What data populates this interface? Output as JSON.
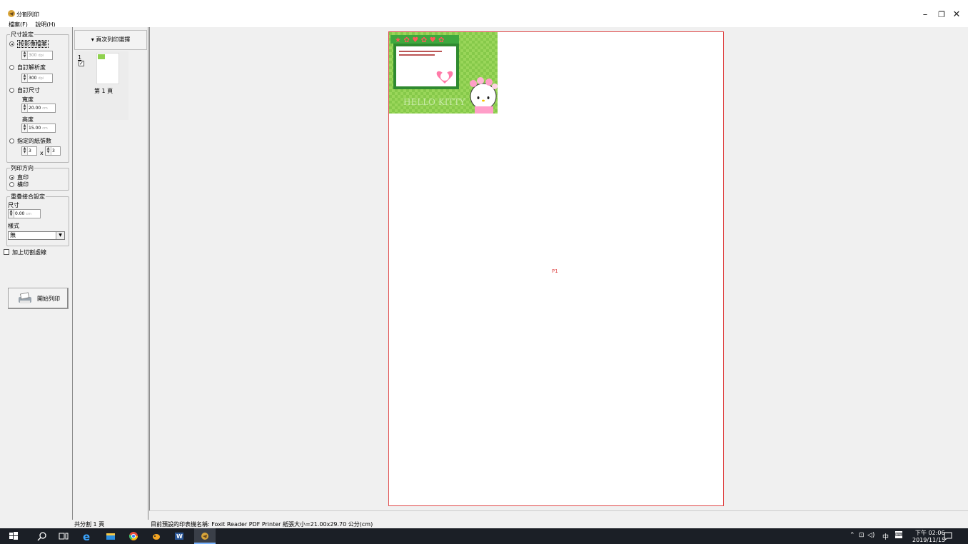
{
  "window": {
    "title": "分割列印",
    "menu": [
      "檔案(F)",
      "說明(H)"
    ],
    "controls": {
      "minimize": "–",
      "restore": "❐",
      "close": "✕"
    }
  },
  "size_settings": {
    "legend": "尺寸設定",
    "by_image": {
      "label": "按影像檔案",
      "value": "300",
      "unit": "dpi",
      "selected": true
    },
    "custom_resolution": {
      "label": "自訂解析度",
      "value": "300",
      "unit": "dpi"
    },
    "custom_size": {
      "label": "自訂尺寸",
      "width_label": "寬度",
      "width_value": "20.00",
      "height_label": "高度",
      "height_value": "15.00",
      "unit": "cm"
    },
    "page_count": {
      "label": "指定的紙張數",
      "cols": "3",
      "rows": "3",
      "separator": "x"
    }
  },
  "orientation": {
    "legend": "列印方向",
    "portrait": "直印",
    "landscape": "橫印",
    "selected": "portrait"
  },
  "overlap": {
    "legend": "重疊接合設定",
    "size_label": "尺寸",
    "size_value": "0.00",
    "unit": "cm",
    "style_label": "樣式",
    "style_value": "無"
  },
  "cut_lines": {
    "label": "加上切割虛線",
    "checked": false
  },
  "print_button": {
    "label": "開始列印"
  },
  "page_select": {
    "header": "▾ 頁次列印選擇",
    "page_index": "1",
    "page_caption": "第 1 頁",
    "checked": true
  },
  "preview": {
    "page_label": "P1",
    "image_caption": "HELLO KITTY"
  },
  "status": {
    "pages_total": "共分割 1 頁",
    "printer_info": "目前預設的印表機名稱: Foxit Reader PDF Printer   紙張大小=21.00x29.70 公分(cm)"
  },
  "taskbar": {
    "time": "下午 02:06",
    "date": "2019/11/15",
    "ime": "中"
  },
  "colors": {
    "page_border": "#e04848",
    "taskbar_bg": "#1b1f26"
  }
}
